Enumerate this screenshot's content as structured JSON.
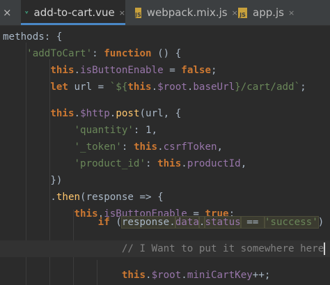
{
  "tabs": [
    {
      "label": "add-to-cart.vue",
      "icon": "vue-icon",
      "active": true
    },
    {
      "label": "webpack.mix.js",
      "icon": "js-icon",
      "active": false
    },
    {
      "label": "app.js",
      "icon": "js-icon",
      "active": false
    }
  ],
  "left_tab_close": "×",
  "close_glyph": "×",
  "js_icon_text": "JS",
  "code_lines": [
    [
      [
        "plain",
        "methods: {"
      ]
    ],
    [
      [
        "plain",
        "    "
      ],
      [
        "str",
        "'addToCart'"
      ],
      [
        "plain",
        ": "
      ],
      [
        "kw",
        "function"
      ],
      [
        "plain",
        " () {"
      ]
    ],
    [
      [
        "plain",
        "        "
      ],
      [
        "kw",
        "this"
      ],
      [
        "plain",
        "."
      ],
      [
        "prop",
        "isButtonEnable"
      ],
      [
        "plain",
        " = "
      ],
      [
        "kw",
        "false"
      ],
      [
        "plain",
        ";"
      ]
    ],
    [
      [
        "plain",
        "        "
      ],
      [
        "kw",
        "let"
      ],
      [
        "plain",
        " url = "
      ],
      [
        "str",
        "`${"
      ],
      [
        "kw",
        "this"
      ],
      [
        "plain",
        "."
      ],
      [
        "prop",
        "$root"
      ],
      [
        "plain",
        "."
      ],
      [
        "prop",
        "baseUrl"
      ],
      [
        "str",
        "}/cart/add`"
      ],
      [
        "plain",
        ";"
      ]
    ],
    [
      [
        "plain",
        ""
      ]
    ],
    [
      [
        "plain",
        "        "
      ],
      [
        "kw",
        "this"
      ],
      [
        "plain",
        "."
      ],
      [
        "prop",
        "$http"
      ],
      [
        "plain",
        "."
      ],
      [
        "fn",
        "post"
      ],
      [
        "plain",
        "(url, {"
      ]
    ],
    [
      [
        "plain",
        "            "
      ],
      [
        "str",
        "'quantity'"
      ],
      [
        "plain",
        ": 1,"
      ]
    ],
    [
      [
        "plain",
        "            "
      ],
      [
        "str",
        "'_token'"
      ],
      [
        "plain",
        ": "
      ],
      [
        "kw",
        "this"
      ],
      [
        "plain",
        "."
      ],
      [
        "prop",
        "csrfToken"
      ],
      [
        "plain",
        ","
      ]
    ],
    [
      [
        "plain",
        "            "
      ],
      [
        "str",
        "'product_id'"
      ],
      [
        "plain",
        ": "
      ],
      [
        "kw",
        "this"
      ],
      [
        "plain",
        "."
      ],
      [
        "prop",
        "productId"
      ],
      [
        "plain",
        ","
      ]
    ],
    [
      [
        "plain",
        "        })"
      ]
    ],
    [
      [
        "plain",
        "        ."
      ],
      [
        "fn",
        "then"
      ],
      [
        "plain",
        "(response => {"
      ]
    ],
    [
      [
        "plain",
        "            "
      ],
      [
        "kw",
        "this"
      ],
      [
        "plain",
        "."
      ],
      [
        "prop",
        "isButtonEnable"
      ],
      [
        "plain",
        " = "
      ],
      [
        "kw",
        "true"
      ],
      [
        "plain",
        ";"
      ]
    ],
    [
      [
        "plain",
        ""
      ]
    ],
    [
      [
        "plain",
        "                "
      ],
      [
        "kw",
        "if"
      ],
      [
        "plain",
        " ("
      ],
      [
        "hl-plain",
        "response."
      ],
      [
        "hl-prop",
        "data"
      ],
      [
        "hl-plain",
        "."
      ],
      [
        "hl-prop",
        "status"
      ],
      [
        "hl-plain",
        " == "
      ],
      [
        "hl-str",
        "'success'"
      ],
      [
        "plain",
        ") {"
      ]
    ],
    [
      [
        "plain",
        ""
      ]
    ],
    [
      [
        "plain",
        "                    "
      ],
      [
        "cmt",
        "// I Want to put it somewhere here"
      ],
      [
        "caret",
        ""
      ]
    ],
    [
      [
        "plain",
        ""
      ]
    ],
    [
      [
        "plain",
        "                    "
      ],
      [
        "kw",
        "this"
      ],
      [
        "plain",
        "."
      ],
      [
        "prop",
        "$root"
      ],
      [
        "plain",
        "."
      ],
      [
        "prop",
        "miniCartKey"
      ],
      [
        "plain",
        "++;"
      ]
    ]
  ]
}
